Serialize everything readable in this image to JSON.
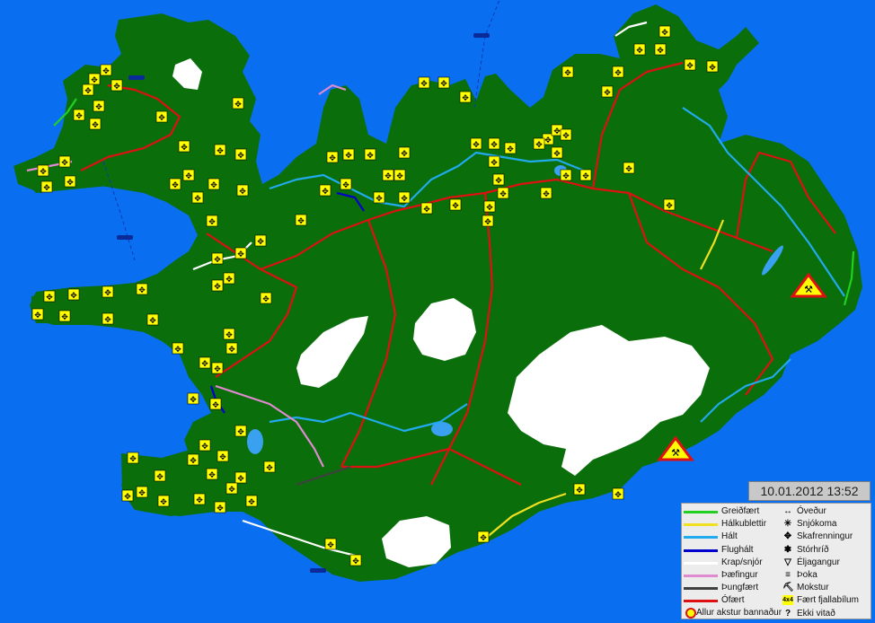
{
  "timestamp": "10.01.2012 13:52",
  "colors": {
    "sea": "#0a6ef0",
    "land": "#0a6e0a",
    "glacier": "#ffffff",
    "road_ofaert": "#dd1111",
    "road_halt": "#22aaee",
    "road_thaefingur": "#e08ad0",
    "road_krap": "#ffffff",
    "road_halkublettir": "#f0e020",
    "road_greidfaert": "#22d022",
    "road_flughalt": "#0000cc",
    "road_thungfaert": "#404040",
    "sign_fill": "#ffff00"
  },
  "legend": {
    "roads": [
      {
        "label": "Greiðfært",
        "color": "#22d022",
        "name": "greidfaert"
      },
      {
        "label": "Hálkublettir",
        "color": "#f0e020",
        "name": "halkublettir"
      },
      {
        "label": "Hált",
        "color": "#22aaee",
        "name": "halt"
      },
      {
        "label": "Flughált",
        "color": "#0000cc",
        "name": "flughalt"
      },
      {
        "label": "Krap/snjór",
        "color": "#ffffff",
        "name": "krap-snjor"
      },
      {
        "label": "Þæfingur",
        "color": "#e08ad0",
        "name": "thaefingur"
      },
      {
        "label": "Þungfært",
        "color": "#404040",
        "name": "thungfaert"
      },
      {
        "label": "Ófært",
        "color": "#dd1111",
        "name": "ofaert"
      }
    ],
    "closed_label": "Allur akstur bannaður",
    "conditions": [
      {
        "label": "Óveður",
        "symbol": "↔",
        "name": "oveður-icon"
      },
      {
        "label": "Snjókoma",
        "symbol": "✳",
        "name": "snjokoma-icon"
      },
      {
        "label": "Skafrenningur",
        "symbol": "✥",
        "name": "skafrenningur-icon"
      },
      {
        "label": "Stórhríð",
        "symbol": "❃",
        "name": "storhrid-icon"
      },
      {
        "label": "Éljagangur",
        "symbol": "▽",
        "name": "eljagangur-icon"
      },
      {
        "label": "Þoka",
        "symbol": "≡",
        "name": "thoka-icon"
      },
      {
        "label": "Mokstur",
        "symbol": "⛏",
        "name": "mokstur-icon"
      },
      {
        "label": "Fært fjallabílum",
        "symbol": "4x4",
        "name": "faert-fjallabilum-icon"
      },
      {
        "label": "Ekki vitað",
        "symbol": "?",
        "name": "ekki-vitad-icon"
      }
    ]
  }
}
